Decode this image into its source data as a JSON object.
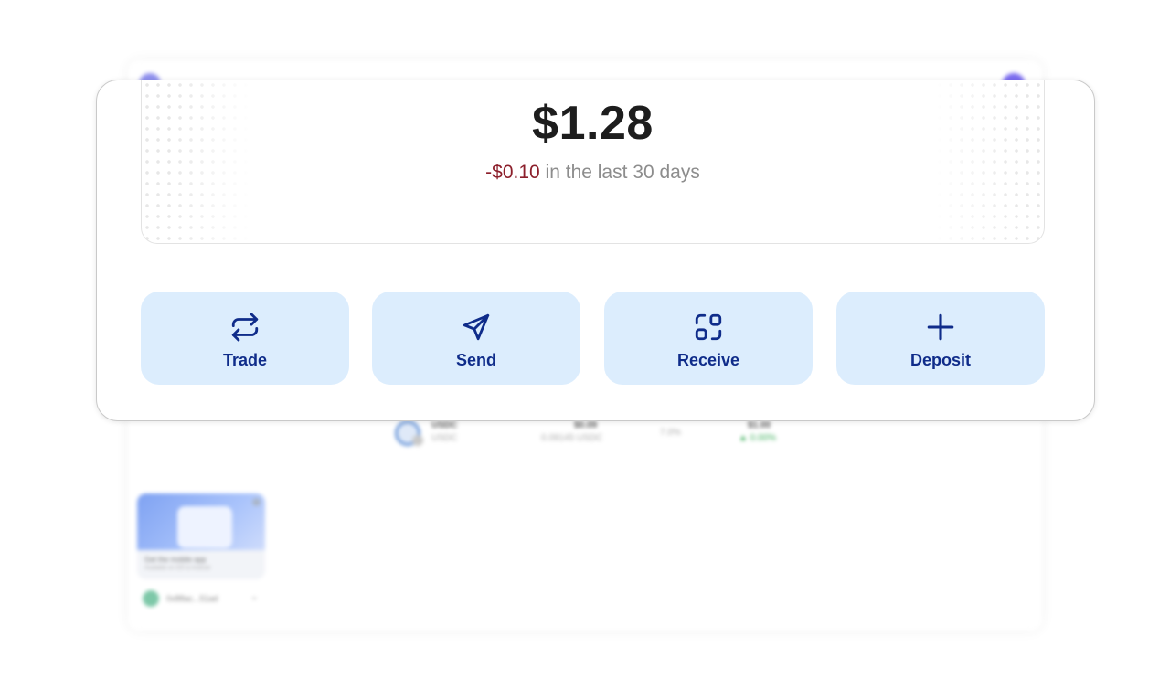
{
  "background": {
    "asset_row": {
      "symbol": "USDC",
      "name": "USDC",
      "value": "$0.09",
      "amount": "0.09145 USDC",
      "allocation": "7.0%",
      "price": "$1.00",
      "change": "▲ 0.00%"
    },
    "promo": {
      "title": "Get the mobile app",
      "subtitle": "Available on iOS & Android"
    },
    "wallet": {
      "address": "0x88ac...51ad"
    }
  },
  "balance": {
    "amount": "$1.28",
    "change_value": "-$0.10",
    "change_suffix": " in the last 30 days"
  },
  "actions": [
    {
      "label": "Trade",
      "icon": "swap-arrows-icon"
    },
    {
      "label": "Send",
      "icon": "send-arrow-icon"
    },
    {
      "label": "Receive",
      "icon": "qr-scan-icon"
    },
    {
      "label": "Deposit",
      "icon": "plus-icon"
    }
  ],
  "colors": {
    "action_bg": "#dcedfd",
    "action_text": "#0f2c8a",
    "negative": "#8c1f2b",
    "muted": "#8d8d8d"
  }
}
